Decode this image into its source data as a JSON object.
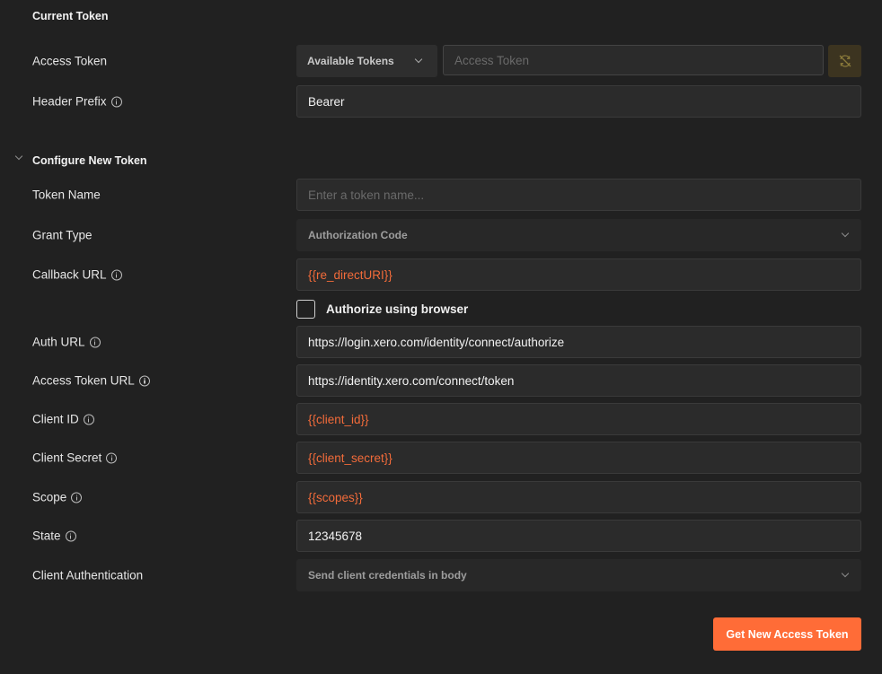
{
  "current_token": {
    "section_title": "Current Token",
    "access_token_label": "Access Token",
    "available_tokens_label": "Available Tokens",
    "access_token_placeholder": "Access Token",
    "header_prefix_label": "Header Prefix",
    "header_prefix_value": "Bearer"
  },
  "configure": {
    "section_title": "Configure New Token",
    "fields": {
      "token_name": {
        "label": "Token Name",
        "placeholder": "Enter a token name..."
      },
      "grant_type": {
        "label": "Grant Type",
        "value": "Authorization Code"
      },
      "callback_url": {
        "label": "Callback URL",
        "value": "{{re_directURI}}"
      },
      "authorize_browser": {
        "label": "Authorize using browser",
        "checked": false
      },
      "auth_url": {
        "label": "Auth URL",
        "value": "https://login.xero.com/identity/connect/authorize"
      },
      "access_token_url": {
        "label": "Access Token URL",
        "value": "https://identity.xero.com/connect/token"
      },
      "client_id": {
        "label": "Client ID",
        "value": "{{client_id}}"
      },
      "client_secret": {
        "label": "Client Secret",
        "value": "{{client_secret}}"
      },
      "scope": {
        "label": "Scope",
        "value": "{{scopes}}"
      },
      "state": {
        "label": "State",
        "value": "12345678"
      },
      "client_authentication": {
        "label": "Client Authentication",
        "value": "Send client credentials in body"
      }
    },
    "submit_label": "Get New Access Token"
  },
  "icons": {
    "info": "info-icon",
    "chevron": "chevron-down-icon",
    "sync": "sync-disabled-icon"
  },
  "colors": {
    "background": "#212121",
    "field_background": "#2b2b2b",
    "variable_text": "#f26b3a",
    "accent": "#ff6c37"
  }
}
